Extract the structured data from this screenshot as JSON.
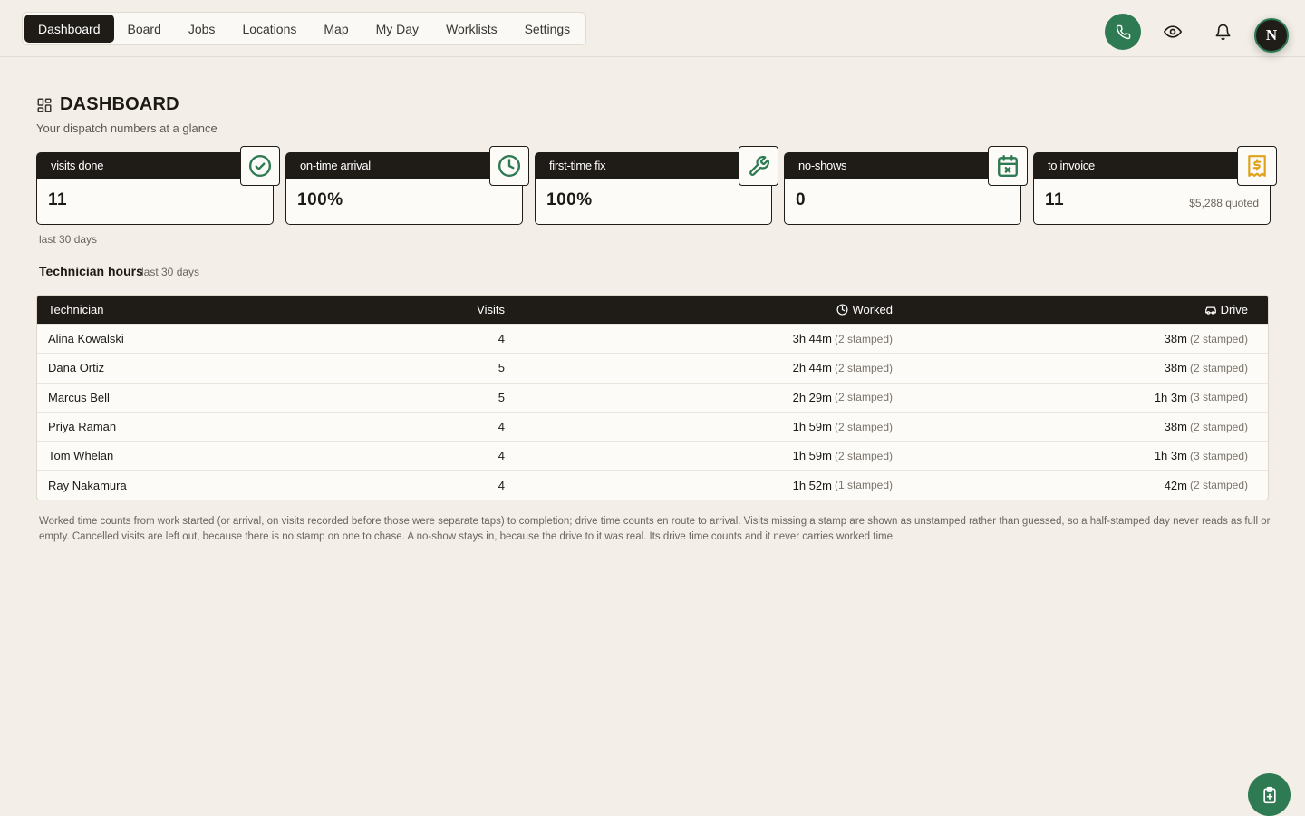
{
  "nav": {
    "items": [
      {
        "label": "Dashboard",
        "active": true
      },
      {
        "label": "Board"
      },
      {
        "label": "Jobs"
      },
      {
        "label": "Locations"
      },
      {
        "label": "Map"
      },
      {
        "label": "My Day"
      },
      {
        "label": "Worklists"
      },
      {
        "label": "Settings"
      }
    ]
  },
  "user": {
    "initial": "N"
  },
  "page": {
    "title": "DASHBOARD",
    "subtitle": "Your dispatch numbers at a glance"
  },
  "cards": [
    {
      "label": "visits done",
      "value": "11",
      "icon": "check-circle-icon"
    },
    {
      "label": "on-time arrival",
      "value": "100%",
      "icon": "clock-icon"
    },
    {
      "label": "first-time fix",
      "value": "100%",
      "icon": "wrench-icon"
    },
    {
      "label": "no-shows",
      "value": "0",
      "icon": "calendar-x-icon"
    },
    {
      "label": "to invoice",
      "value": "11",
      "extra": "$5,288 quoted",
      "icon": "receipt-dollar-icon"
    }
  ],
  "range_note": "last 30 days",
  "section": {
    "title": "Technician hours",
    "sub": "last 30 days"
  },
  "table": {
    "headers": {
      "technician": "Technician",
      "visits": "Visits",
      "worked": "Worked",
      "drive": "Drive"
    },
    "rows": [
      {
        "name": "Alina Kowalski",
        "visits": "4",
        "worked": "3h 44m",
        "worked_stamp": "(2 stamped)",
        "drive": "38m",
        "drive_stamp": "(2 stamped)"
      },
      {
        "name": "Dana Ortiz",
        "visits": "5",
        "worked": "2h 44m",
        "worked_stamp": "(2 stamped)",
        "drive": "38m",
        "drive_stamp": "(2 stamped)"
      },
      {
        "name": "Marcus Bell",
        "visits": "5",
        "worked": "2h 29m",
        "worked_stamp": "(2 stamped)",
        "drive": "1h 3m",
        "drive_stamp": "(3 stamped)"
      },
      {
        "name": "Priya Raman",
        "visits": "4",
        "worked": "1h 59m",
        "worked_stamp": "(2 stamped)",
        "drive": "38m",
        "drive_stamp": "(2 stamped)"
      },
      {
        "name": "Tom Whelan",
        "visits": "4",
        "worked": "1h 59m",
        "worked_stamp": "(2 stamped)",
        "drive": "1h 3m",
        "drive_stamp": "(3 stamped)"
      },
      {
        "name": "Ray Nakamura",
        "visits": "4",
        "worked": "1h 52m",
        "worked_stamp": "(1 stamped)",
        "drive": "42m",
        "drive_stamp": "(2 stamped)"
      }
    ]
  },
  "footnote": "Worked time counts from work started (or arrival, on visits recorded before those were separate taps) to completion; drive time counts en route to arrival. Visits missing a stamp are shown as unstamped rather than guessed, so a half-stamped day never reads as full or empty. Cancelled visits are left out, because there is no stamp on one to chase. A no-show stays in, because the drive to it was real. Its drive time counts and it never carries worked time.",
  "colors": {
    "accent": "#2e7a52",
    "dark": "#1f1c18",
    "background": "#f3efe8",
    "invoice_icon": "#e0a21a"
  }
}
